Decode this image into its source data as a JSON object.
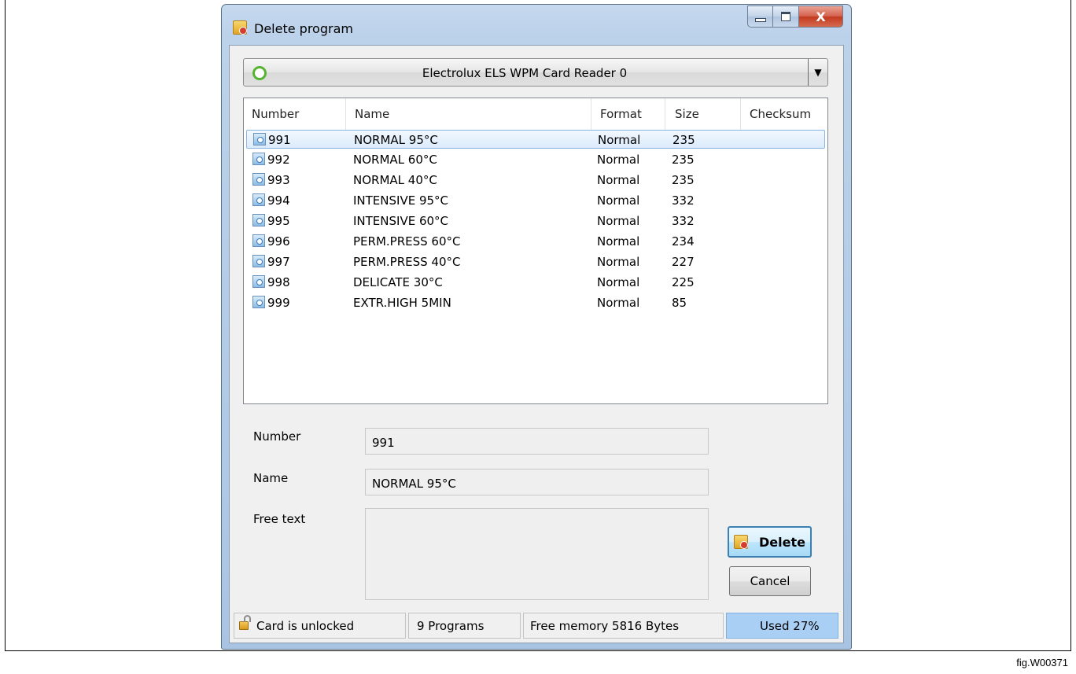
{
  "window": {
    "title": "Delete program",
    "close_glyph": "X"
  },
  "reader": {
    "label": "Electrolux ELS WPM Card Reader 0",
    "status": "connected",
    "status_color": "#56b330"
  },
  "list": {
    "columns": [
      "Number",
      "Name",
      "Format",
      "Size",
      "Checksum"
    ],
    "rows": [
      {
        "number": "991",
        "name": "NORMAL 95°C",
        "format": "Normal",
        "size": "235",
        "checksum": "",
        "selected": true
      },
      {
        "number": "992",
        "name": "NORMAL 60°C",
        "format": "Normal",
        "size": "235",
        "checksum": ""
      },
      {
        "number": "993",
        "name": "NORMAL 40°C",
        "format": "Normal",
        "size": "235",
        "checksum": ""
      },
      {
        "number": "994",
        "name": "INTENSIVE 95°C",
        "format": "Normal",
        "size": "332",
        "checksum": ""
      },
      {
        "number": "995",
        "name": "INTENSIVE 60°C",
        "format": "Normal",
        "size": "332",
        "checksum": ""
      },
      {
        "number": "996",
        "name": "PERM.PRESS 60°C",
        "format": "Normal",
        "size": "234",
        "checksum": ""
      },
      {
        "number": "997",
        "name": "PERM.PRESS 40°C",
        "format": "Normal",
        "size": "227",
        "checksum": ""
      },
      {
        "number": "998",
        "name": "DELICATE 30°C",
        "format": "Normal",
        "size": "225",
        "checksum": ""
      },
      {
        "number": "999",
        "name": "EXTR.HIGH 5MIN",
        "format": "Normal",
        "size": "85",
        "checksum": ""
      }
    ]
  },
  "details": {
    "number_label": "Number",
    "number_value": "991",
    "name_label": "Name",
    "name_value": "NORMAL 95°C",
    "freetext_label": "Free text",
    "freetext_value": ""
  },
  "buttons": {
    "delete": "Delete",
    "cancel": "Cancel"
  },
  "status": {
    "lock": "Card is unlocked",
    "programs": "9 Programs",
    "free_memory": "Free memory 5816 Bytes",
    "used": "Used 27%"
  },
  "figure_label": "fig.W00371"
}
